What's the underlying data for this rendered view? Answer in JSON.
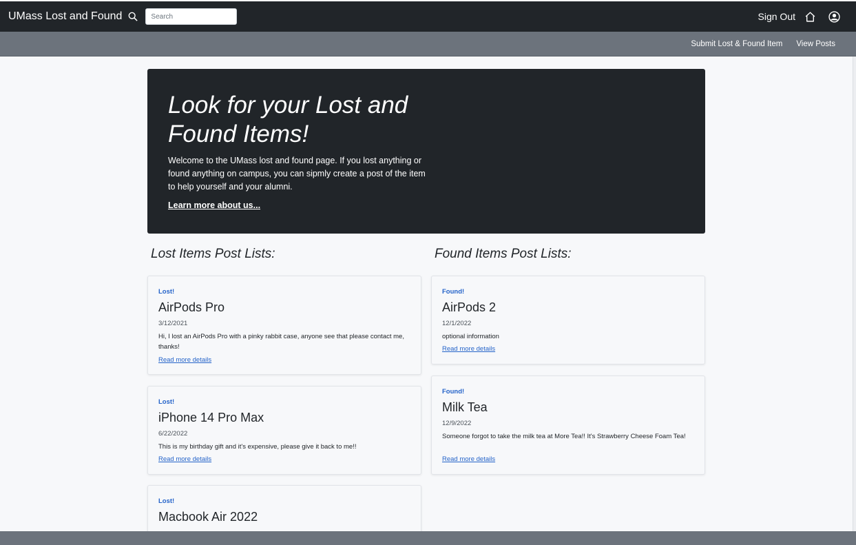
{
  "app": {
    "title": "UMass Lost and Found",
    "search_placeholder": "Search",
    "sign_out": "Sign Out"
  },
  "subnav": {
    "submit": "Submit Lost & Found Item",
    "view_posts": "View Posts"
  },
  "hero": {
    "title": "Look for your Lost and Found Items!",
    "text": "Welcome to the UMass lost and found page. If you lost anything or found anything on campus, you can sipmly create a post of the item to help yourself and your alumni.",
    "link": "Learn more about us..."
  },
  "lost": {
    "heading": "Lost Items Post Lists:",
    "items": [
      {
        "status": "Lost!",
        "name": "AirPods Pro",
        "date": "3/12/2021",
        "desc": "Hi, I lost an AirPods Pro with a pinky rabbit case, anyone see that please contact me, thanks!",
        "link": "Read more details"
      },
      {
        "status": "Lost!",
        "name": "iPhone 14 Pro Max",
        "date": "6/22/2022",
        "desc": "This is my birthday gift and it's expensive, please give it back to me!!",
        "link": "Read more details"
      },
      {
        "status": "Lost!",
        "name": "Macbook Air 2022"
      }
    ]
  },
  "found": {
    "heading": "Found Items Post Lists:",
    "items": [
      {
        "status": "Found!",
        "name": "AirPods 2",
        "date": "12/1/2022",
        "desc": "optional information",
        "link": "Read more details"
      },
      {
        "status": "Found!",
        "name": "Milk Tea",
        "date": "12/9/2022",
        "desc": "Someone forgot to take the milk tea at More Tea!! It's Strawberry Cheese Foam Tea!",
        "link": "Read more details"
      }
    ]
  },
  "icons": {
    "search": "search-icon",
    "home": "home-icon",
    "user": "user-circle-icon"
  },
  "colors": {
    "navbar": "#212529",
    "subnav": "#6c737c",
    "accent": "#2463c9"
  }
}
